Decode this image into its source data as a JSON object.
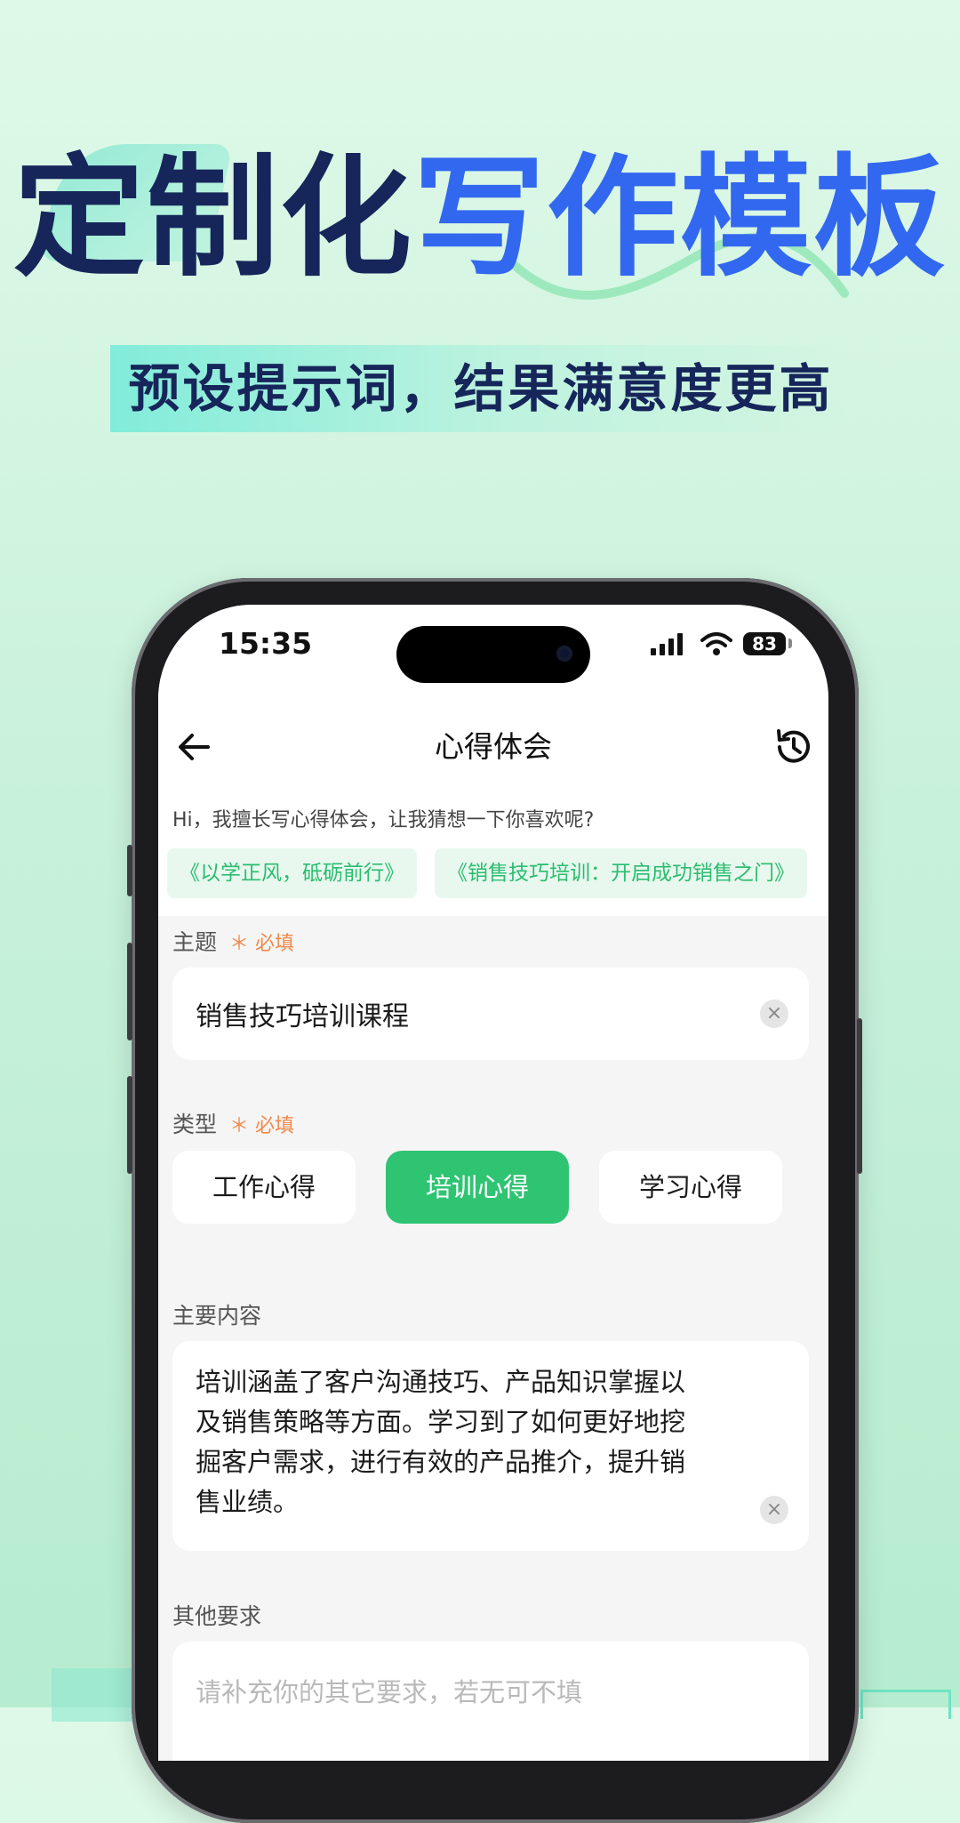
{
  "promo": {
    "headline_dark": "定制化",
    "headline_blue": "写作模板",
    "subtitle": "预设提示词，结果满意度更高"
  },
  "status_bar": {
    "time": "15:35",
    "battery": "83"
  },
  "nav": {
    "title": "心得体会",
    "back_icon": "arrow-left-icon",
    "history_icon": "history-icon"
  },
  "intro": {
    "greeting": "Hi，我擅长写心得体会，让我猜想一下你喜欢呢?",
    "suggestions": [
      "《以学正风，砥砺前行》",
      "《销售技巧培训：开启成功销售之门》"
    ]
  },
  "form": {
    "topic": {
      "label": "主题",
      "required": "＊ 必填",
      "value": "销售技巧培训课程"
    },
    "type": {
      "label": "类型",
      "required": "＊ 必填",
      "options": [
        "工作心得",
        "培训心得",
        "学习心得"
      ],
      "selected": "培训心得"
    },
    "content": {
      "label": "主要内容",
      "value": "培训涵盖了客户沟通技巧、产品知识掌握以及销售策略等方面。学习到了如何更好地挖掘客户需求，进行有效的产品推介，提升销售业绩。"
    },
    "other": {
      "label": "其他要求",
      "placeholder": "请补充你的其它要求，若无可不填"
    }
  },
  "colors": {
    "accent_green": "#2ec472",
    "headline_blue": "#3268ef",
    "headline_dark": "#16265a",
    "required_orange": "#f08a4b"
  }
}
